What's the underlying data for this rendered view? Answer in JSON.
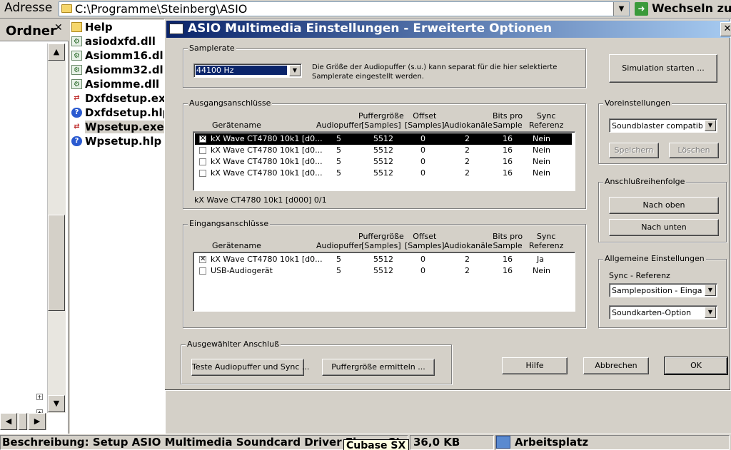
{
  "explorer": {
    "address_label": "Adresse",
    "address_value": "C:\\Programme\\Steinberg\\ASIO",
    "go_label": "Wechseln zu",
    "folders_title": "Ordner",
    "files": [
      {
        "name": "Help",
        "type": "folder-icon"
      },
      {
        "name": "asiodxfd.dll",
        "type": "dll-icon"
      },
      {
        "name": "Asiomm16.dll",
        "type": "dll-icon"
      },
      {
        "name": "Asiomm32.dll",
        "type": "dll-icon"
      },
      {
        "name": "Asiomme.dll",
        "type": "dll-icon"
      },
      {
        "name": "Dxfdsetup.exe",
        "type": "setup-exe-icon"
      },
      {
        "name": "Dxfdsetup.hlp",
        "type": "help-file-icon"
      },
      {
        "name": "Wpsetup.exe",
        "type": "setup-exe-icon",
        "selected": true
      },
      {
        "name": "Wpsetup.hlp",
        "type": "help-file-icon"
      }
    ]
  },
  "dialog": {
    "title": "ASIO Multimedia Einstellungen  - Erweiterte Optionen",
    "samplerate": {
      "group_label": "Samplerate",
      "selected": "44100 Hz",
      "note": "Die Größe der Audiopuffer (s.u.) kann separat für die hier selektierte Samplerate eingestellt werden."
    },
    "simulation_button": "Simulation starten ...",
    "columns": {
      "device": "Gerätename",
      "buffers": "Audiopuffer",
      "buffer_size": "Puffergröße\n[Samples]",
      "offset": "Offset\n[Samples]",
      "channels": "Audiokanäle",
      "bits": "Bits pro\nSample",
      "sync": "Sync\nReferenz"
    },
    "outputs": {
      "group_label": "Ausgangsanschlüsse",
      "rows": [
        {
          "checked": true,
          "selected": true,
          "device": "kX Wave CT4780 10k1 [d0...",
          "buffers": "5",
          "size": "5512",
          "offset": "0",
          "channels": "2",
          "bits": "16",
          "sync": "Nein"
        },
        {
          "checked": false,
          "selected": false,
          "device": "kX Wave CT4780 10k1 [d0...",
          "buffers": "5",
          "size": "5512",
          "offset": "0",
          "channels": "2",
          "bits": "16",
          "sync": "Nein"
        },
        {
          "checked": false,
          "selected": false,
          "device": "kX Wave CT4780 10k1 [d0...",
          "buffers": "5",
          "size": "5512",
          "offset": "0",
          "channels": "2",
          "bits": "16",
          "sync": "Nein"
        },
        {
          "checked": false,
          "selected": false,
          "device": "kX Wave CT4780 10k1 [d0...",
          "buffers": "5",
          "size": "5512",
          "offset": "0",
          "channels": "2",
          "bits": "16",
          "sync": "Nein"
        }
      ],
      "selected_caption": "kX Wave CT4780 10k1 [d000] 0/1"
    },
    "inputs": {
      "group_label": "Eingangsanschlüsse",
      "rows": [
        {
          "checked": true,
          "selected": false,
          "device": "kX Wave CT4780 10k1 [d0...",
          "buffers": "5",
          "size": "5512",
          "offset": "0",
          "channels": "2",
          "bits": "16",
          "sync": "Ja"
        },
        {
          "checked": false,
          "selected": false,
          "device": "USB-Audiogerät",
          "buffers": "5",
          "size": "5512",
          "offset": "0",
          "channels": "2",
          "bits": "16",
          "sync": "Nein"
        }
      ]
    },
    "presets": {
      "group_label": "Voreinstellungen",
      "selected": "Soundblaster compatible ...",
      "save": "Speichern",
      "delete": "Löschen"
    },
    "order": {
      "group_label": "Anschlußreihenfolge",
      "up": "Nach oben",
      "down": "Nach unten"
    },
    "general": {
      "group_label": "Allgemeine Einstellungen",
      "sync_label": "Sync - Referenz",
      "sync_value": "Sampleposition - Eingang",
      "card_value": "Soundkarten-Option"
    },
    "selected_port": {
      "group_label": "Ausgewählter Anschluß",
      "test_button": "Teste Audiopuffer und Sync ...",
      "detect_button": "Puffergröße ermitteln ..."
    },
    "help_button": "Hilfe",
    "cancel_button": "Abbrechen",
    "ok_button": "OK"
  },
  "status": {
    "description": "Beschreibung: Setup ASIO Multimedia Soundcard Driver Firma: Steinberg",
    "size": "36,0 KB",
    "location": "Arbeitsplatz",
    "tooltip": "Cubase SX"
  }
}
